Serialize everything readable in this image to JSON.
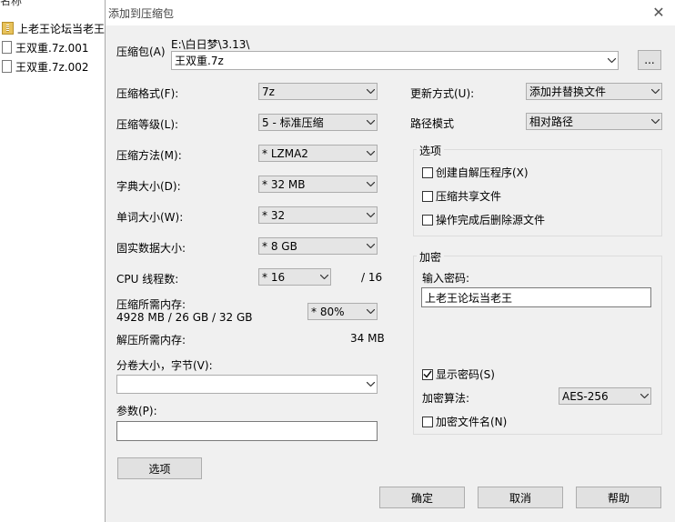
{
  "explorer": {
    "header": "名称",
    "items": [
      {
        "name": "上老王论坛当老王",
        "type": "folder"
      },
      {
        "name": "王双重.7z.001",
        "type": "file"
      },
      {
        "name": "王双重.7z.002",
        "type": "file"
      }
    ]
  },
  "dialog": {
    "title": "添加到压缩包",
    "archive": {
      "label": "压缩包(A)",
      "path": "E:\\白日梦\\3.13\\",
      "filename": "王双重.7z",
      "browse_label": "..."
    },
    "format": {
      "label": "压缩格式(F):",
      "value": "7z"
    },
    "level": {
      "label": "压缩等级(L):",
      "value": "5 - 标准压缩"
    },
    "method": {
      "label": "压缩方法(M):",
      "value": "* LZMA2"
    },
    "dict": {
      "label": "字典大小(D):",
      "value": "* 32 MB"
    },
    "word": {
      "label": "单词大小(W):",
      "value": "* 32"
    },
    "solid": {
      "label": "固实数据大小:",
      "value": "* 8 GB"
    },
    "cpu": {
      "label": "CPU 线程数:",
      "value": "* 16",
      "total": "/ 16"
    },
    "mem_compress": {
      "label": "压缩所需内存:",
      "detail": "4928 MB / 26 GB / 32 GB",
      "value": "* 80%"
    },
    "mem_decompress": {
      "label": "解压所需内存:",
      "value": "34 MB"
    },
    "split": {
      "label": "分卷大小，字节(V):",
      "value": ""
    },
    "params": {
      "label": "参数(P):",
      "value": ""
    },
    "update": {
      "label": "更新方式(U):",
      "value": "添加并替换文件"
    },
    "path_mode": {
      "label": "路径模式",
      "value": "相对路径"
    },
    "options": {
      "title": "选项",
      "sfx": {
        "label": "创建自解压程序(X)",
        "checked": false
      },
      "shared": {
        "label": "压缩共享文件",
        "checked": false
      },
      "delete": {
        "label": "操作完成后删除源文件",
        "checked": false
      }
    },
    "encryption": {
      "title": "加密",
      "password_label": "输入密码:",
      "password": "上老王论坛当老王",
      "show_password": {
        "label": "显示密码(S)",
        "checked": true
      },
      "method_label": "加密算法:",
      "method_value": "AES-256",
      "encrypt_names": {
        "label": "加密文件名(N)",
        "checked": false
      }
    },
    "buttons": {
      "options": "选项",
      "ok": "确定",
      "cancel": "取消",
      "help": "帮助"
    }
  }
}
